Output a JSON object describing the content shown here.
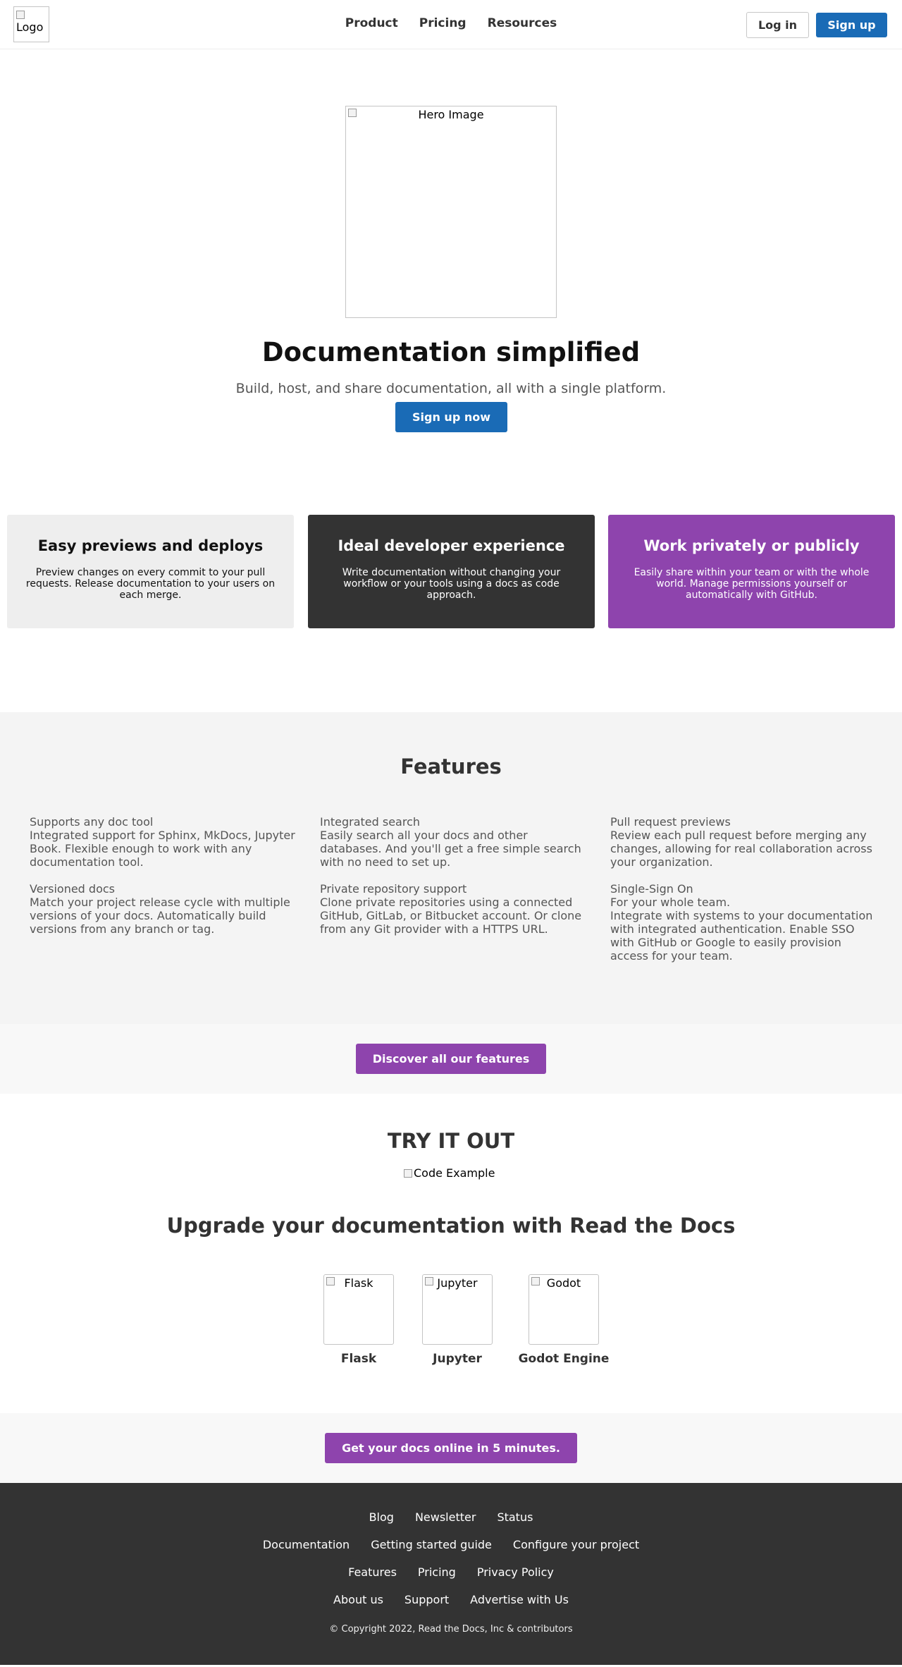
{
  "header": {
    "logo_alt": "Logo",
    "nav": [
      "Product",
      "Pricing",
      "Resources"
    ],
    "login_label": "Log in",
    "signup_label": "Sign up"
  },
  "hero": {
    "image_alt": "Hero Image",
    "title": "Documentation simplified",
    "subtitle": "Build, host, and share documentation, all with a single platform.",
    "cta_label": "Sign up now"
  },
  "cards": [
    {
      "title": "Easy previews and deploys",
      "text": "Preview changes on every commit to your pull requests. Release documentation to your users on each merge."
    },
    {
      "title": "Ideal developer experience",
      "text": "Write documentation without changing your workflow or your tools using a docs as code approach."
    },
    {
      "title": "Work privately or publicly",
      "text": "Easily share within your team or with the whole world. Manage permissions yourself or automatically with GitHub."
    }
  ],
  "features": {
    "title": "Features",
    "items": [
      {
        "title": "Supports any doc tool",
        "text": "Integrated support for Sphinx, MkDocs, Jupyter Book. Flexible enough to work with any documentation tool."
      },
      {
        "title": "Versioned docs",
        "text": "Match your project release cycle with multiple versions of your docs. Automatically build versions from any branch or tag."
      },
      {
        "title": "Integrated search",
        "text": "Easily search all your docs and other databases. And you'll get a free simple search with no need to set up."
      },
      {
        "title": "Private repository support",
        "text": "Clone private repositories using a connected GitHub, GitLab, or Bitbucket account. Or clone from any Git provider with a HTTPS URL."
      },
      {
        "title": "Pull request previews",
        "text": "Review each pull request before merging any changes, allowing for real collaboration across your organization."
      },
      {
        "title": "Single-Sign On",
        "subtitle": "For your whole team.",
        "text": "Integrate with systems to your documentation with integrated authentication. Enable SSO with GitHub or Google to easily provision access for your team."
      }
    ],
    "discover_label": "Discover all our features"
  },
  "tryout": {
    "title": "TRY IT OUT",
    "code_image_alt": "Code Example",
    "upgrade_title": "Upgrade your documentation with Read the Docs",
    "projects": [
      {
        "alt": "Flask",
        "name": "Flask"
      },
      {
        "alt": "Jupyter",
        "name": "Jupyter"
      },
      {
        "alt": "Godot",
        "name": "Godot Engine"
      }
    ],
    "getdocs_label": "Get your docs online in 5 minutes."
  },
  "footer": {
    "row1": [
      "Blog",
      "Newsletter",
      "Status"
    ],
    "row2": [
      "Documentation",
      "Getting started guide",
      "Configure your project"
    ],
    "row3": [
      "Features",
      "Pricing",
      "Privacy Policy"
    ],
    "row4": [
      "About us",
      "Support",
      "Advertise with Us"
    ],
    "copyright": "© Copyright 2022, Read the Docs, Inc & contributors"
  },
  "colors": {
    "primary_blue": "#1a6bb6",
    "purple": "#8e44ad",
    "dark": "#333333",
    "light_gray": "#eeeeee"
  }
}
